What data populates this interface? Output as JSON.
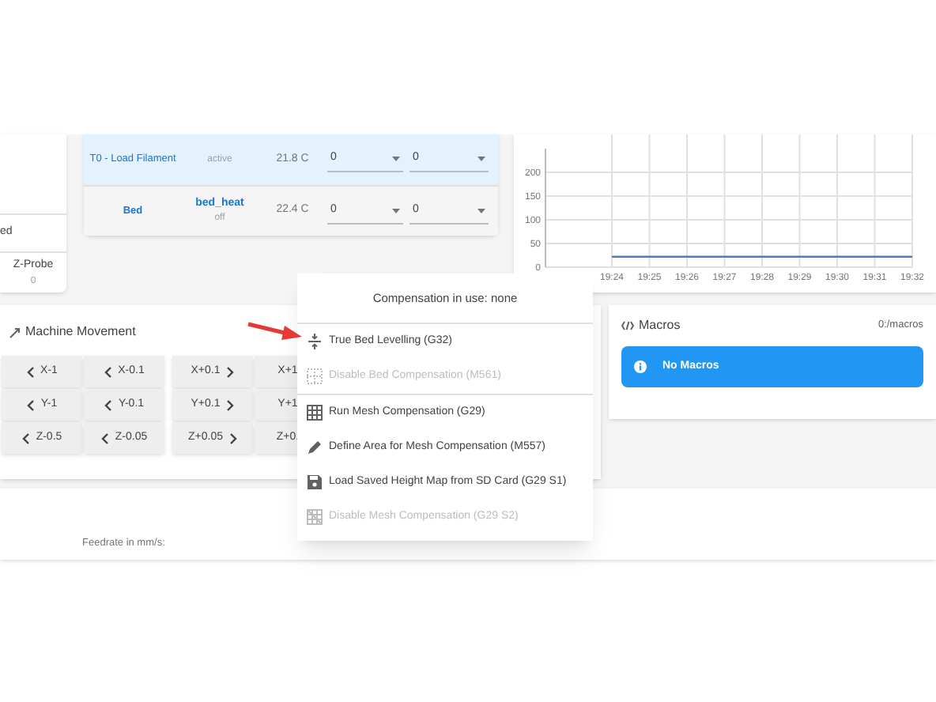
{
  "status_card": {
    "label": "ed",
    "probe_label": "Z-Probe",
    "probe_value": "0"
  },
  "heaters": [
    {
      "name": "T0 - Load Filament",
      "state": "active",
      "current": "21.8 C",
      "active_temp": "0",
      "standby_temp": "0",
      "selected": true
    },
    {
      "name": "Bed",
      "heater": "bed_heat",
      "state": "off",
      "current": "22.4 C",
      "active_temp": "0",
      "standby_temp": "0",
      "selected": false
    }
  ],
  "chart": {
    "chart_data": {
      "type": "line",
      "categories": [
        "19:24",
        "19:25",
        "19:26",
        "19:27",
        "19:28",
        "19:29",
        "19:30",
        "19:31",
        "19:32"
      ],
      "series": [
        {
          "color": "#4a7fc1",
          "values": [
            22,
            22,
            22,
            22,
            22,
            22,
            22,
            22,
            22
          ]
        }
      ],
      "ylim": [
        0,
        250
      ],
      "yticks": [
        0,
        50,
        100,
        150,
        200
      ],
      "grid": true
    }
  },
  "movement": {
    "title": "Machine Movement",
    "rows": [
      [
        {
          "label": "X-1",
          "kind": "minus"
        },
        {
          "label": "X-0.1",
          "kind": "minus"
        },
        {
          "label": "X+0.1",
          "kind": "plus"
        },
        {
          "label": "X+1",
          "kind": "plus"
        }
      ],
      [
        {
          "label": "Y-1",
          "kind": "minus"
        },
        {
          "label": "Y-0.1",
          "kind": "minus"
        },
        {
          "label": "Y+0.1",
          "kind": "plus"
        },
        {
          "label": "Y+1",
          "kind": "plus"
        }
      ],
      [
        {
          "label": "Z-0.5",
          "kind": "minus"
        },
        {
          "label": "Z-0.05",
          "kind": "minus"
        },
        {
          "label": "Z+0.05",
          "kind": "plus"
        },
        {
          "label": "Z+0.",
          "kind": "plus"
        }
      ]
    ]
  },
  "feedrate_label": "Feedrate in mm/s:",
  "macros": {
    "title": "Macros",
    "path": "0:/macros",
    "alert": "No Macros"
  },
  "menu": {
    "header": "Compensation in use: none",
    "items": [
      {
        "label": "True Bed Levelling (G32)",
        "kind": "level",
        "disabled": false,
        "divider_after": false
      },
      {
        "label": "Disable Bed Compensation (M561)",
        "kind": "grid-dashed",
        "disabled": true,
        "divider_after": true
      },
      {
        "label": "Run Mesh Compensation (G29)",
        "kind": "grid",
        "disabled": false,
        "divider_after": false
      },
      {
        "label": "Define Area for Mesh Compensation (M557)",
        "kind": "pencil",
        "disabled": false,
        "divider_after": false
      },
      {
        "label": "Load Saved Height Map from SD Card (G29 S1)",
        "kind": "save",
        "disabled": false,
        "divider_after": false
      },
      {
        "label": "Disable Mesh Compensation (G29 S2)",
        "kind": "grid-off",
        "disabled": true,
        "divider_after": false
      }
    ]
  }
}
